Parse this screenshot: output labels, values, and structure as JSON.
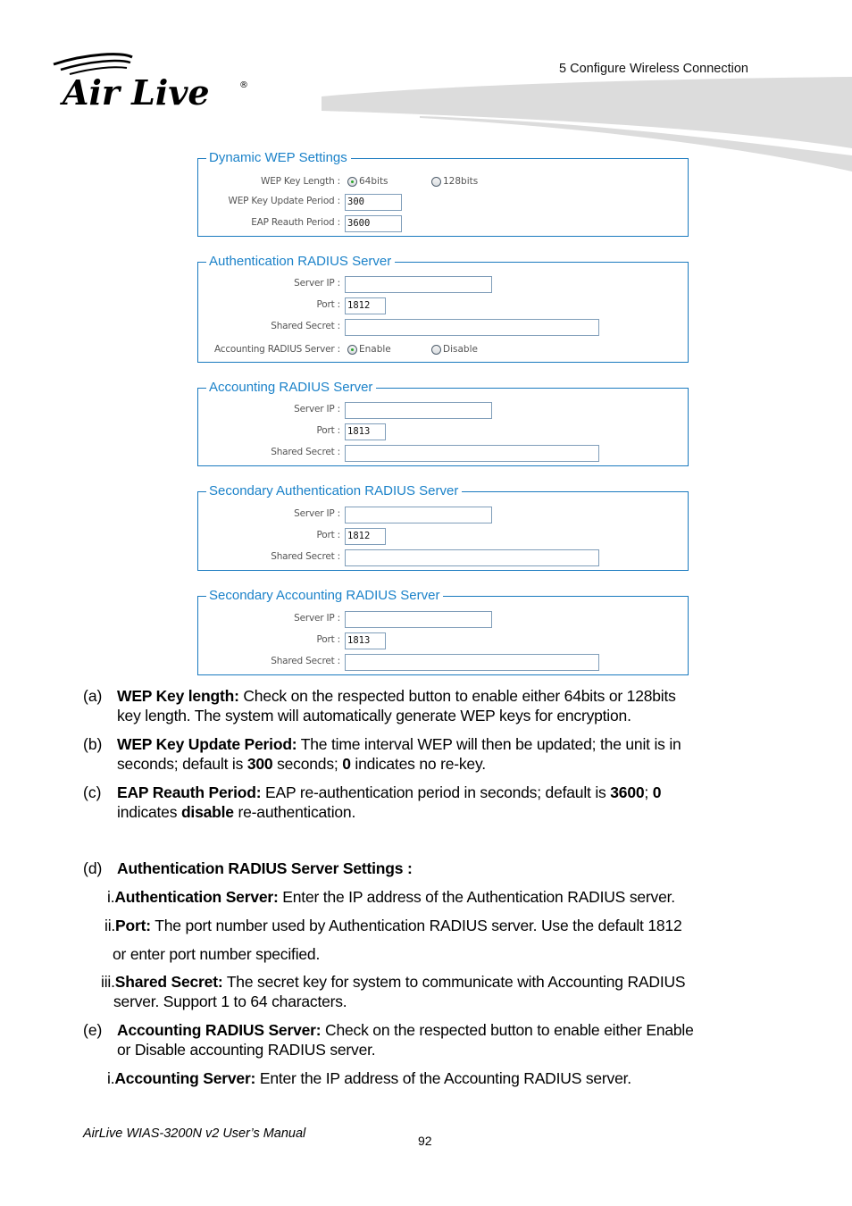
{
  "header": {
    "logo_text": "Air Live",
    "logo_registered": "®",
    "chapter_title": "5 Configure Wireless Connection"
  },
  "accent_color": "#1b82c9",
  "sections": {
    "dynamic_wep": {
      "title": "Dynamic WEP Settings",
      "wep_key_length_label": "WEP Key Length :",
      "wep_key_length_options": [
        "64bits",
        "128bits"
      ],
      "wep_key_length_selected": "64bits",
      "wep_key_update_period_label": "WEP Key Update Period :",
      "wep_key_update_period_value": "300",
      "eap_reauth_period_label": "EAP Reauth Period :",
      "eap_reauth_period_value": "3600"
    },
    "auth_radius": {
      "title": "Authentication RADIUS Server",
      "server_ip_label": "Server IP :",
      "server_ip_value": "",
      "port_label": "Port :",
      "port_value": "1812",
      "shared_secret_label": "Shared Secret :",
      "shared_secret_value": "",
      "accounting_label": "Accounting RADIUS Server :",
      "accounting_options": [
        "Enable",
        "Disable"
      ],
      "accounting_selected": "Enable"
    },
    "acct_radius": {
      "title": "Accounting RADIUS Server",
      "server_ip_label": "Server IP :",
      "server_ip_value": "",
      "port_label": "Port :",
      "port_value": "1813",
      "shared_secret_label": "Shared Secret :",
      "shared_secret_value": ""
    },
    "sec_auth_radius": {
      "title": "Secondary Authentication RADIUS Server",
      "server_ip_label": "Server IP :",
      "server_ip_value": "",
      "port_label": "Port :",
      "port_value": "1812",
      "shared_secret_label": "Shared Secret :",
      "shared_secret_value": ""
    },
    "sec_acct_radius": {
      "title": "Secondary Accounting RADIUS Server",
      "server_ip_label": "Server IP :",
      "server_ip_value": "",
      "port_label": "Port :",
      "port_value": "1813",
      "shared_secret_label": "Shared Secret :",
      "shared_secret_value": ""
    }
  },
  "descriptions": {
    "a": {
      "marker": "(a)",
      "term": "WEP Key length:",
      "line1": " Check on the respected button to enable either 64bits or 128bits",
      "line2": "key length. The system will automatically generate WEP keys for encryption."
    },
    "b": {
      "marker": "(b)",
      "term": "WEP Key Update Period:",
      "line1": " The time interval WEP will then be updated; the unit is in",
      "line2_pre": "seconds; default is ",
      "line2_bold1": "300",
      "line2_mid": " seconds; ",
      "line2_bold2": "0",
      "line2_post": " indicates no re-key."
    },
    "c": {
      "marker": "(c)",
      "term": "EAP Reauth Period:",
      "line1_pre": " EAP re-authentication period in seconds; default is ",
      "line1_bold1": "3600",
      "line1_mid": "; ",
      "line1_bold2": "0",
      "line2_pre": "indicates ",
      "line2_bold": "disable",
      "line2_post": " re-authentication."
    },
    "d": {
      "marker": "(d)",
      "term": "Authentication RADIUS Server Settings :",
      "items": [
        {
          "marker": "i.",
          "term": "Authentication Server:",
          "text": " Enter the IP address of the Authentication RADIUS server."
        },
        {
          "marker": "ii.",
          "term": "Port:",
          "text": " The port number used by Authentication RADIUS server. Use the default 1812",
          "cont": "or enter port number specified."
        },
        {
          "marker": "iii.",
          "term": "Shared Secret:",
          "text": " The secret key for system to communicate with Accounting RADIUS",
          "cont": "server. Support 1 to 64 characters."
        }
      ]
    },
    "e": {
      "marker": "(e)",
      "term": "Accounting RADIUS Server:",
      "line1": " Check on the respected button to enable either Enable",
      "line2": "or Disable accounting RADIUS server.",
      "items": [
        {
          "marker": "i.",
          "term": "Accounting Server:",
          "text": " Enter the IP address of the Accounting RADIUS server."
        }
      ]
    }
  },
  "footer": {
    "manual_title": "AirLive WIAS-3200N v2 User’s Manual",
    "page_number": "92"
  }
}
